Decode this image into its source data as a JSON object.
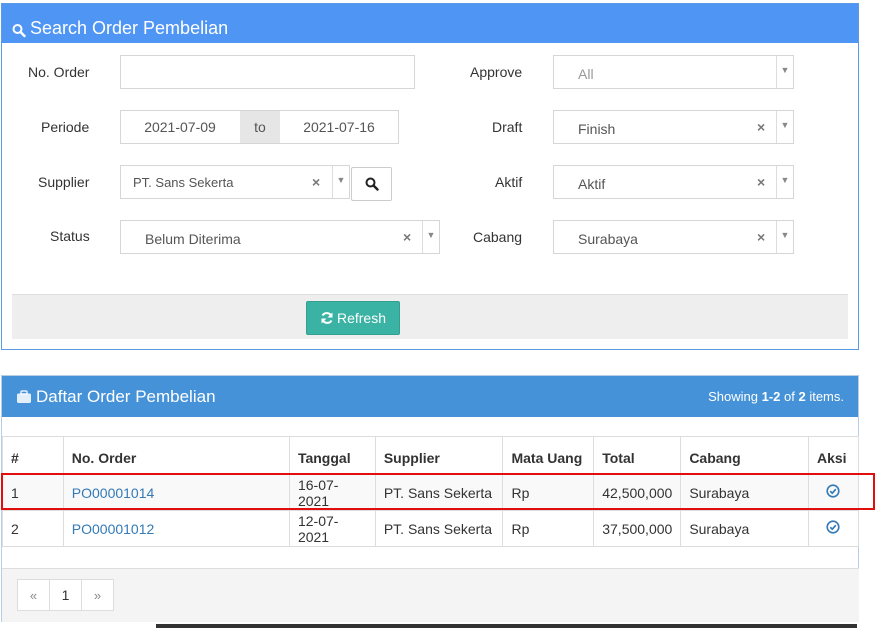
{
  "search_panel": {
    "title": "Search Order Pembelian",
    "no_order": {
      "label": "No. Order",
      "value": ""
    },
    "periode": {
      "label": "Periode",
      "from": "2021-07-09",
      "to_label": "to",
      "to": "2021-07-16"
    },
    "supplier": {
      "label": "Supplier",
      "value": "PT. Sans Sekerta"
    },
    "status": {
      "label": "Status",
      "value": "Belum Diterima"
    },
    "approve": {
      "label": "Approve",
      "value": "All"
    },
    "draft": {
      "label": "Draft",
      "value": "Finish"
    },
    "aktif": {
      "label": "Aktif",
      "value": "Aktif"
    },
    "cabang": {
      "label": "Cabang",
      "value": "Surabaya"
    },
    "refresh_label": "Refresh",
    "clear_symbol": "×",
    "dropdown_symbol": "▼"
  },
  "list_panel": {
    "title": "Daftar Order Pembelian",
    "summary_prefix": "Showing ",
    "summary_range": "1-2",
    "summary_of": " of ",
    "summary_total": "2",
    "summary_suffix": " items.",
    "columns": [
      "#",
      "No. Order",
      "Tanggal",
      "Supplier",
      "Mata Uang",
      "Total",
      "Cabang",
      "Aksi"
    ],
    "rows": [
      {
        "no": "1",
        "order": "PO00001014",
        "tanggal": "16-07-2021",
        "supplier": "PT. Sans Sekerta",
        "mata_uang": "Rp",
        "total": "42,500,000",
        "cabang": "Surabaya"
      },
      {
        "no": "2",
        "order": "PO00001012",
        "tanggal": "12-07-2021",
        "supplier": "PT. Sans Sekerta",
        "mata_uang": "Rp",
        "total": "37,500,000",
        "cabang": "Surabaya"
      }
    ],
    "pagination": {
      "prev": "«",
      "current": "1",
      "next": "»"
    }
  },
  "colors": {
    "search_header": "#4f95f4",
    "list_header": "#4592d8",
    "refresh_button": "#3bb3a4",
    "link": "#337ab7",
    "highlight": "#e20d0d"
  },
  "icons": {
    "search_header": "search-icon",
    "supplier_search": "search-icon",
    "refresh": "refresh-icon",
    "list_header": "briefcase-icon",
    "aksi": "check-circle-icon"
  }
}
